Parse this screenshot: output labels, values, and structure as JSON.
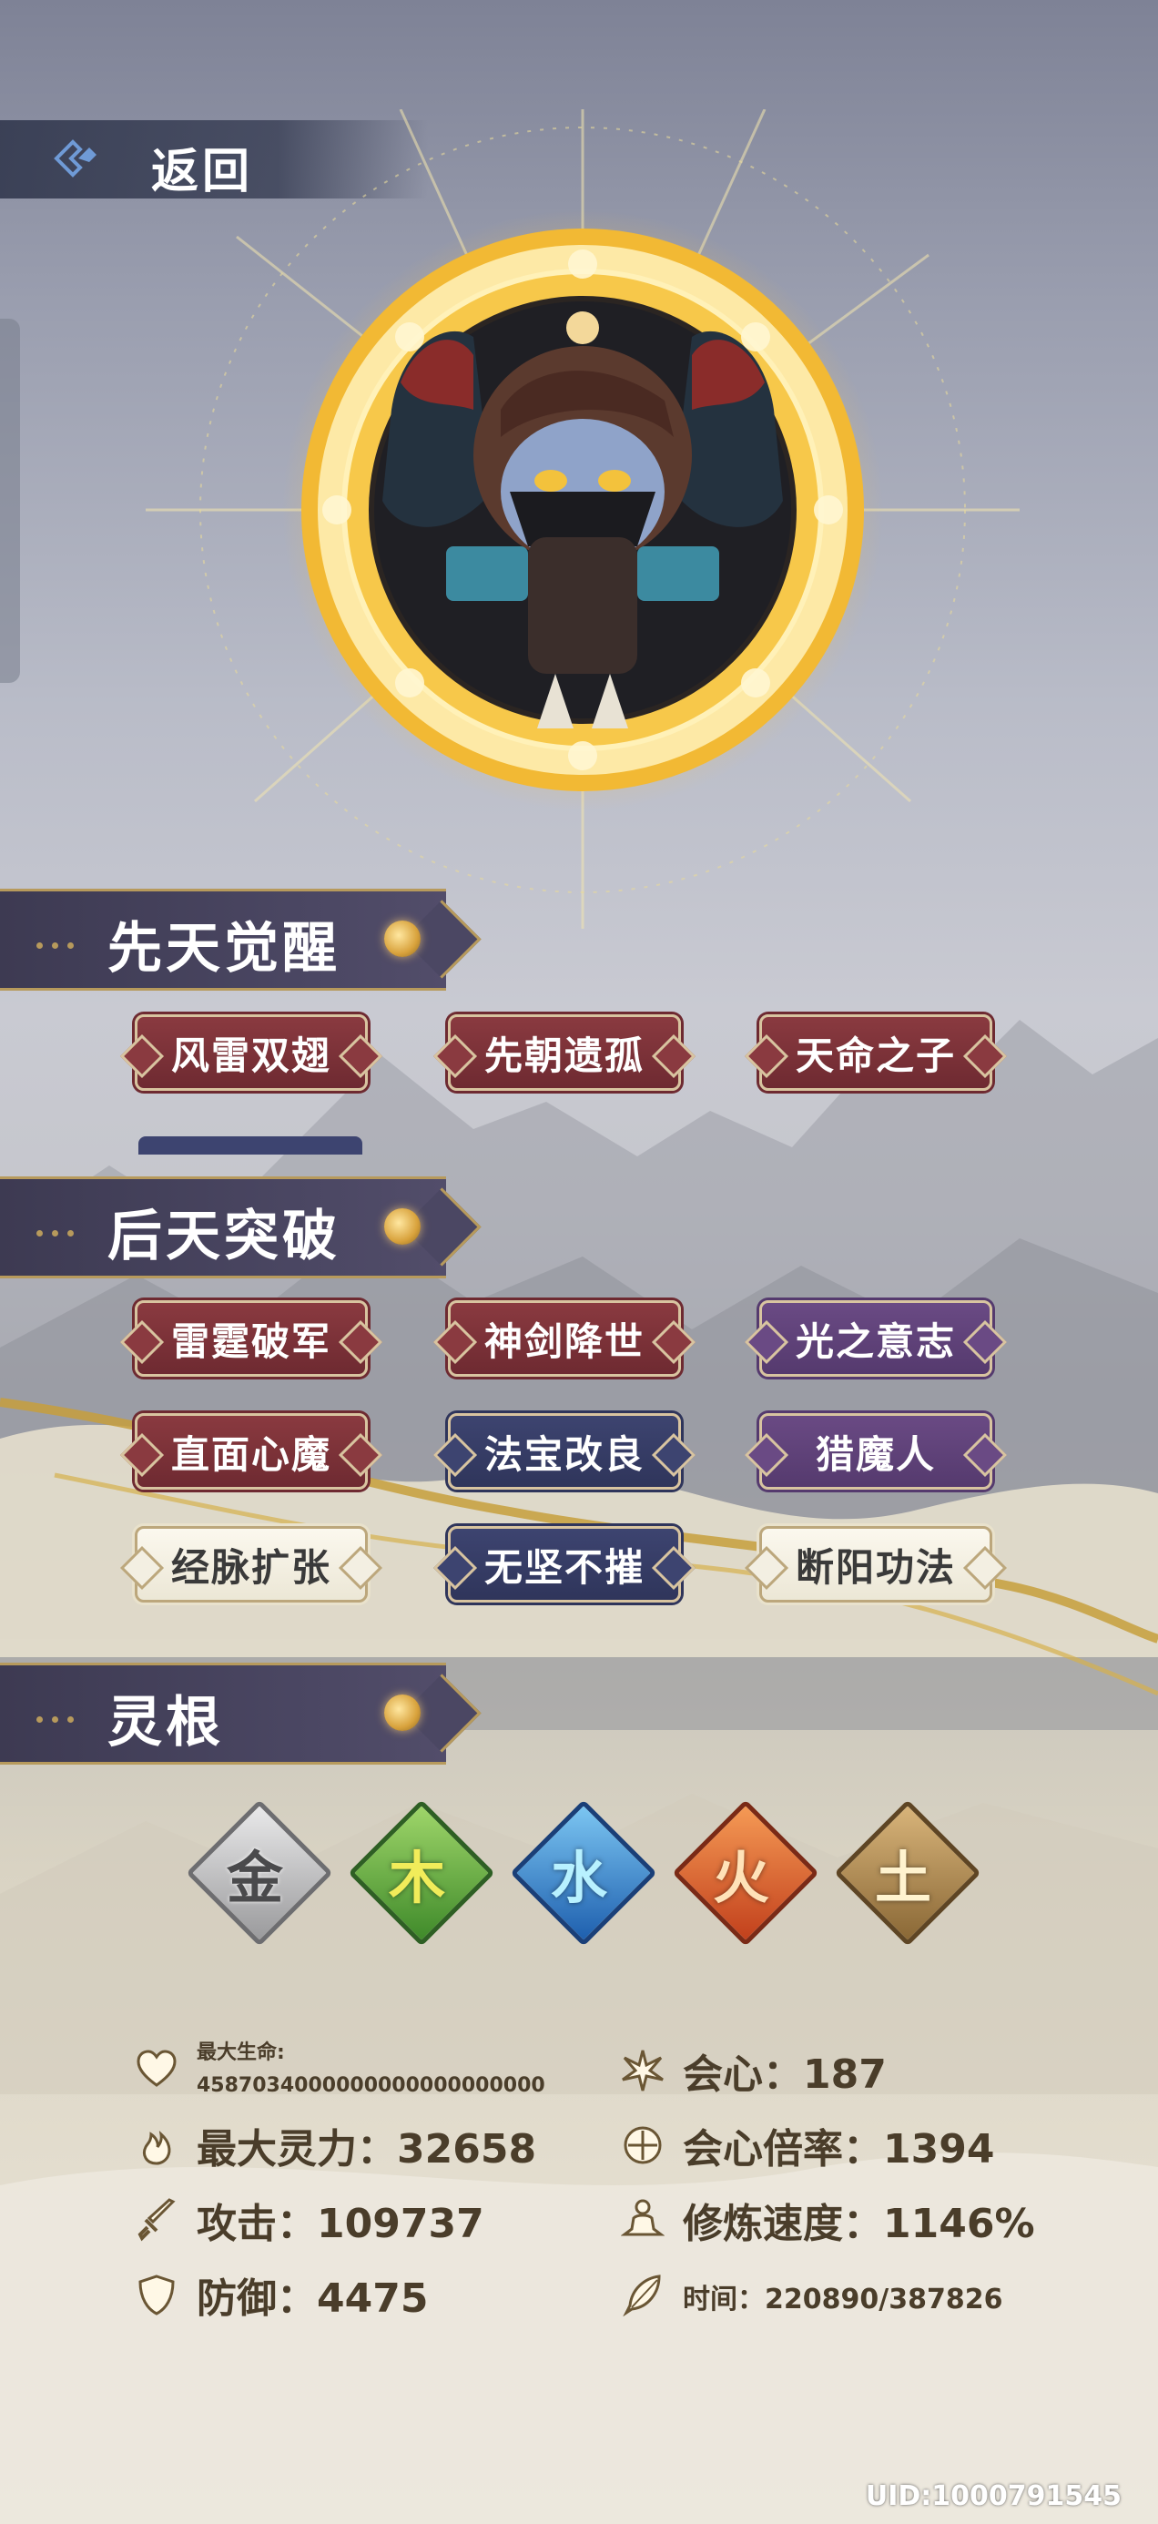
{
  "nav": {
    "back_label": "返回"
  },
  "sections": {
    "innate": {
      "title": "先天觉醒",
      "traits": [
        "风雷双翅",
        "先朝遗孤",
        "天命之子"
      ]
    },
    "acquired": {
      "title": "后天突破",
      "traits": [
        "雷霆破军",
        "神剑降世",
        "光之意志",
        "直面心魔",
        "法宝改良",
        "猎魔人",
        "经脉扩张",
        "无坚不摧",
        "断阳功法"
      ]
    },
    "roots": {
      "title": "灵根",
      "items": [
        "金",
        "木",
        "水",
        "火",
        "土"
      ]
    }
  },
  "stats": {
    "max_hp_label": "最大生命:",
    "max_hp_value": "4587034000000000000000000",
    "max_sp": "最大灵力：32658",
    "attack": "攻击：109737",
    "defense": "防御：4475",
    "crit": "会心：187",
    "crit_mult": "会心倍率：1394",
    "cultivation_speed": "修炼速度：1146%",
    "time": "时间：220890/387826"
  },
  "uid": "UID:1000791545",
  "colors": {
    "red_trait": "#7a3238",
    "purple_trait": "#5f4279",
    "navy_trait": "#363d66",
    "white_trait": "#f4f1e6",
    "header": "#444059",
    "gold": "#b79a5c"
  },
  "icons": [
    "back-icon",
    "heart-icon",
    "flame-icon",
    "sword-icon",
    "shield-icon",
    "burst-icon",
    "crit-circle-icon",
    "meditate-icon",
    "feather-icon"
  ]
}
